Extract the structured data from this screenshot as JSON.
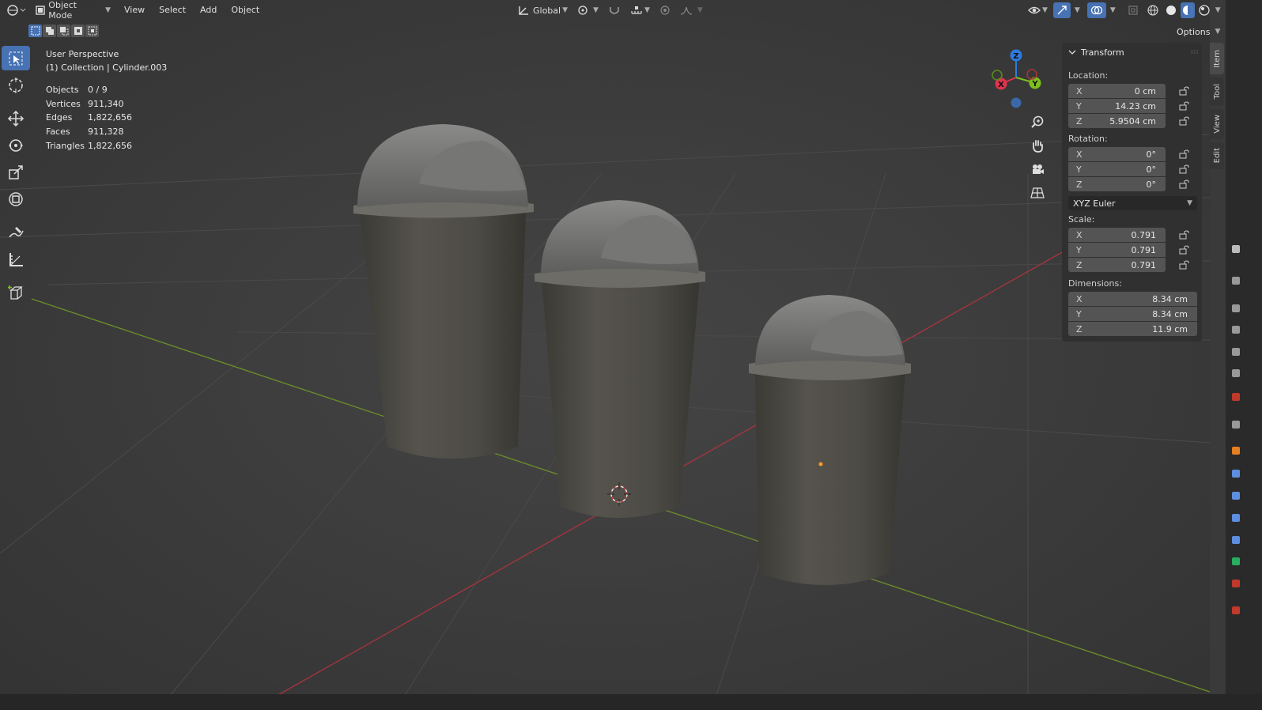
{
  "header": {
    "editor_type_icon": "globe-editor-icon",
    "mode_label": "Object Mode",
    "menus": [
      "View",
      "Select",
      "Add",
      "Object"
    ],
    "orientation_label": "Global"
  },
  "options_label": "Options",
  "overlay": {
    "view_name": "User Perspective",
    "collection_line": "(1) Collection | Cylinder.003"
  },
  "stats": [
    {
      "label": "Objects",
      "value": "0 / 9"
    },
    {
      "label": "Vertices",
      "value": "911,340"
    },
    {
      "label": "Edges",
      "value": "1,822,656"
    },
    {
      "label": "Faces",
      "value": "911,328"
    },
    {
      "label": "Triangles",
      "value": "1,822,656"
    }
  ],
  "gizmo": {
    "x": "X",
    "y": "Y",
    "z": "Z"
  },
  "transform": {
    "title": "Transform",
    "location_label": "Location:",
    "location": [
      {
        "axis": "X",
        "value": "0 cm"
      },
      {
        "axis": "Y",
        "value": "14.23 cm"
      },
      {
        "axis": "Z",
        "value": "5.9504 cm"
      }
    ],
    "rotation_label": "Rotation:",
    "rotation": [
      {
        "axis": "X",
        "value": "0°"
      },
      {
        "axis": "Y",
        "value": "0°"
      },
      {
        "axis": "Z",
        "value": "0°"
      }
    ],
    "rotation_mode": "XYZ Euler",
    "scale_label": "Scale:",
    "scale": [
      {
        "axis": "X",
        "value": "0.791"
      },
      {
        "axis": "Y",
        "value": "0.791"
      },
      {
        "axis": "Z",
        "value": "0.791"
      }
    ],
    "dimensions_label": "Dimensions:",
    "dimensions": [
      {
        "axis": "X",
        "value": "8.34 cm"
      },
      {
        "axis": "Y",
        "value": "8.34 cm"
      },
      {
        "axis": "Z",
        "value": "11.9 cm"
      }
    ]
  },
  "side_tabs": [
    "Item",
    "Tool",
    "View",
    "Edit"
  ],
  "colors": {
    "accent": "#4772b3",
    "x_axis": "#e0334c",
    "y_axis": "#7dbf1f",
    "z_axis": "#2d7be0",
    "origin": "#ff9b1f"
  }
}
